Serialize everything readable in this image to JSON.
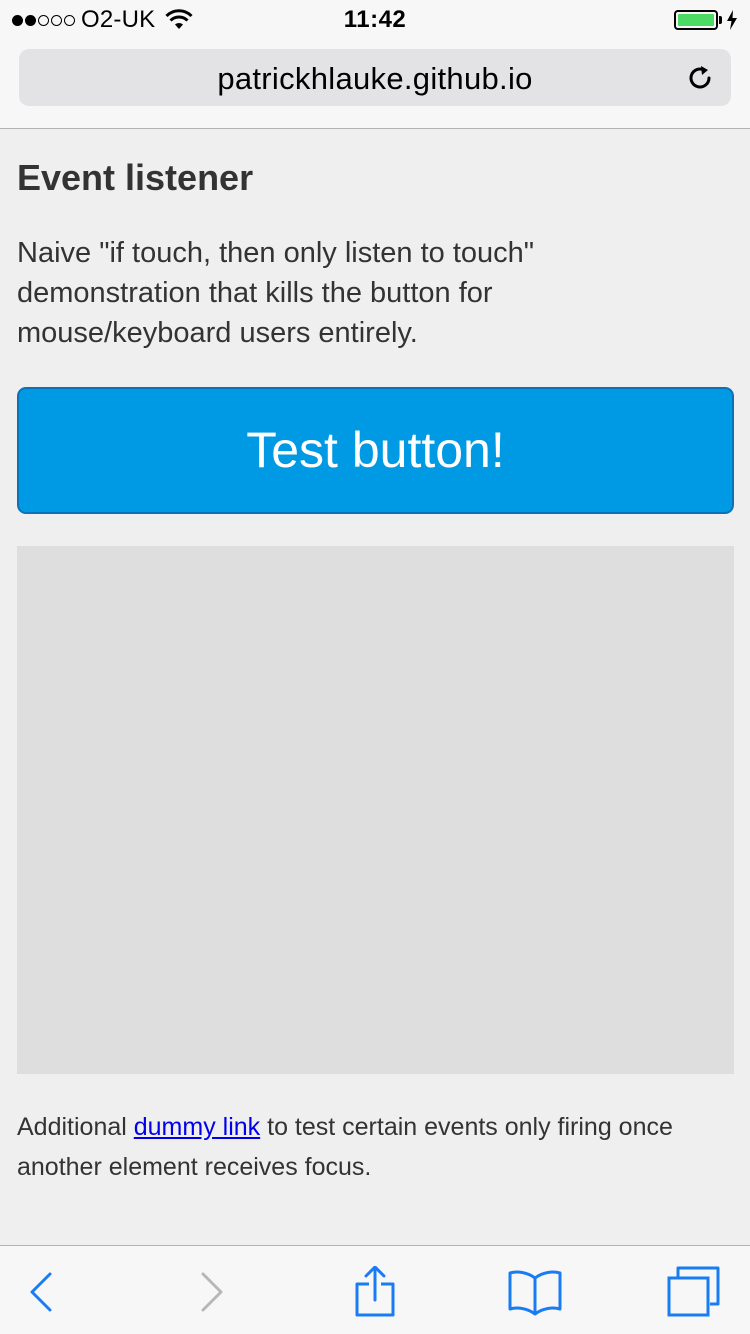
{
  "status_bar": {
    "carrier": "O2-UK",
    "time": "11:42",
    "signal_bars_filled": 2,
    "signal_bars_total": 5,
    "battery_color": "#4cd964"
  },
  "browser": {
    "url": "patrickhlauke.github.io",
    "reload_icon": "reload-icon"
  },
  "page": {
    "title": "Event listener",
    "description": "Naive \"if touch, then only listen to touch\" demonstration that kills the button for mouse/keyboard users entirely.",
    "button_label": "Test button!",
    "button_color": "#0099e3",
    "footer": {
      "before": "Additional ",
      "link": "dummy link",
      "after": " to test certain events only firing once another element receives focus."
    }
  },
  "toolbar": {
    "icons": [
      "back-icon",
      "forward-icon",
      "share-icon",
      "bookmarks-icon",
      "tabs-icon"
    ],
    "accent": "#1a7cf5"
  }
}
